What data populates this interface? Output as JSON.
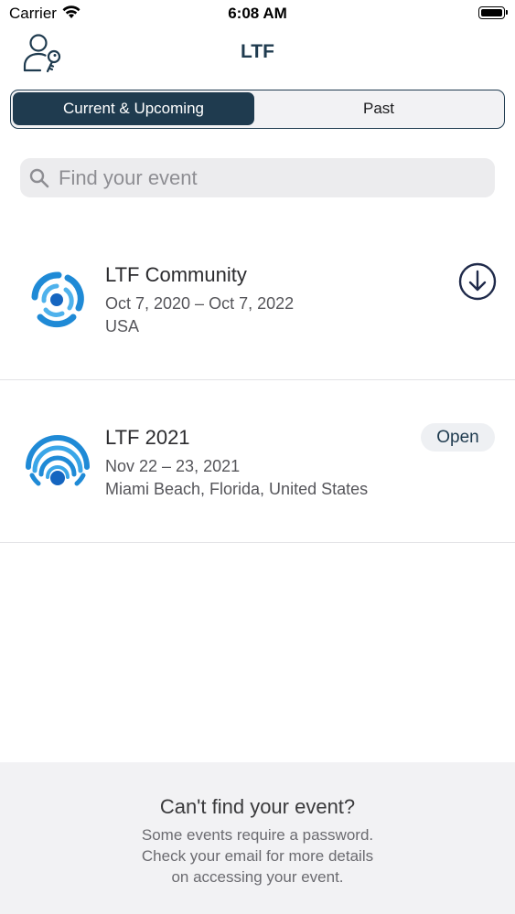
{
  "status_bar": {
    "carrier": "Carrier",
    "time": "6:08 AM",
    "wifi_icon": "wifi-icon",
    "battery_icon": "battery-icon"
  },
  "nav": {
    "title": "LTF",
    "login_icon": "user-key-icon"
  },
  "segments": {
    "active": "Current & Upcoming",
    "inactive": "Past"
  },
  "search": {
    "placeholder": "Find your event",
    "value": "",
    "icon": "search-icon"
  },
  "events": [
    {
      "name": "LTF Community",
      "dates": "Oct 7, 2020 – Oct 7, 2022",
      "location": "USA",
      "action_icon": "download-icon"
    },
    {
      "name": "LTF 2021",
      "dates": "Nov 22 – 23, 2021",
      "location": "Miami Beach, Florida, United States",
      "badge": "Open"
    }
  ],
  "footer": {
    "title": "Can't find your event?",
    "lines": [
      "Some events require a password.",
      "Check your email for more details",
      "on accessing your event."
    ]
  },
  "colors": {
    "primary": "#1f3b4f",
    "logo_blue": "#1f8ad6",
    "logo_dark": "#1565c0"
  }
}
